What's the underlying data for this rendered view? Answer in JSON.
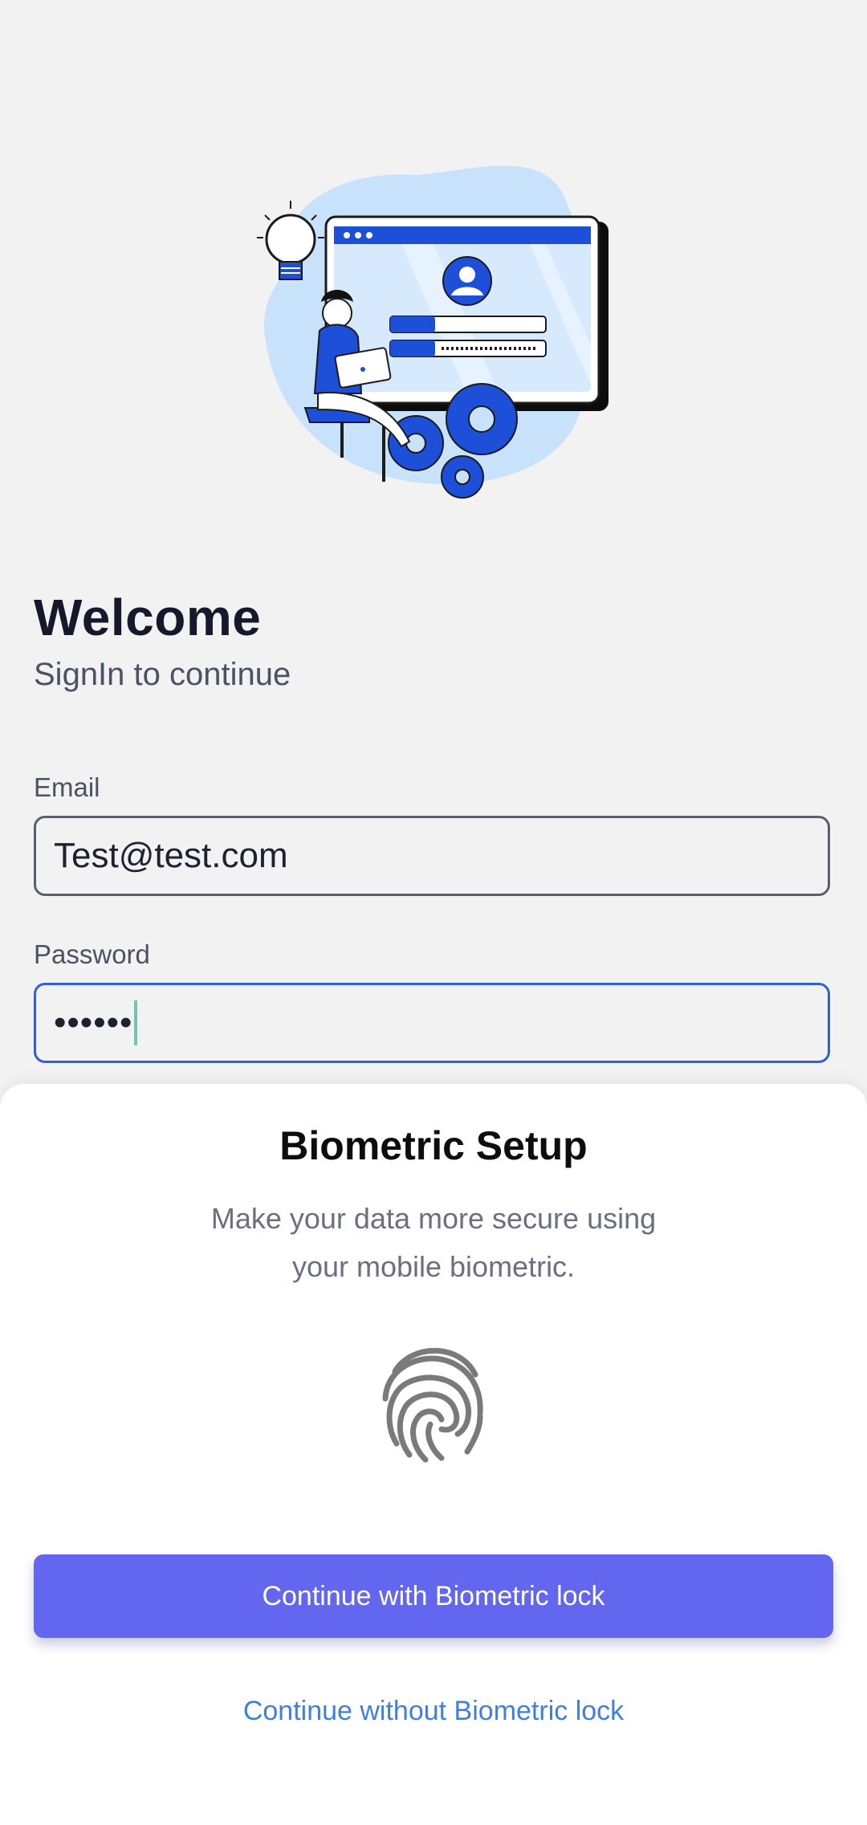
{
  "login": {
    "title": "Welcome",
    "subtitle": "SignIn to continue",
    "email_label": "Email",
    "email_value": "Test@test.com",
    "password_label": "Password",
    "password_value": "••••••"
  },
  "biometric_sheet": {
    "title": "Biometric Setup",
    "description_line1": "Make your data more secure using",
    "description_line2": "your mobile biometric.",
    "primary_button": "Continue with Biometric lock",
    "secondary_link": "Continue without Biometric lock"
  },
  "icons": {
    "hero": "login-illustration",
    "fingerprint": "fingerprint-icon"
  },
  "colors": {
    "primary": "#6366ef",
    "link": "#3f7fe0",
    "focus_border": "#2f5fd9",
    "background": "#f2f2f3"
  }
}
